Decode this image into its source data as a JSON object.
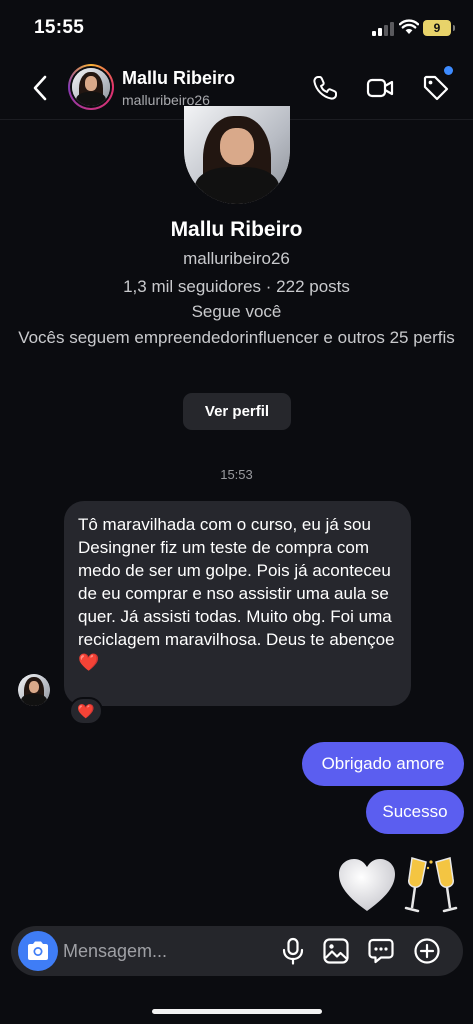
{
  "status_bar": {
    "time": "15:55",
    "battery": "9"
  },
  "header": {
    "name": "Mallu Ribeiro",
    "username": "malluribeiro26"
  },
  "profile": {
    "name": "Mallu Ribeiro",
    "username": "malluribeiro26",
    "stats": "1,3 mil seguidores · 222 posts",
    "follows_you": "Segue você",
    "mutual": "Vocês seguem empreendedorinfluencer e outros 25 perfis",
    "view_profile_label": "Ver perfil"
  },
  "conversation": {
    "timestamp": "15:53",
    "messages": [
      {
        "direction": "incoming",
        "text": "Tô maravilhada com o curso,  eu já sou Desingner fiz um teste de compra com medo de ser um golpe. Pois já aconteceu  de eu comprar e nso assistir uma aula se quer. Já assisti todas.  Muito obg.  Foi uma reciclagem maravilhosa.  Deus te abençoe ❤️",
        "reaction": "❤️"
      },
      {
        "direction": "outgoing",
        "text": "Obrigado amore"
      },
      {
        "direction": "outgoing",
        "text": "Sucesso"
      }
    ],
    "emojis": [
      "white-heart",
      "clinking-glasses"
    ]
  },
  "composer": {
    "placeholder": "Mensagem..."
  },
  "colors": {
    "background": "#0b0c10",
    "outgoing_bubble": "#5b5ef0",
    "incoming_bubble": "#26272d",
    "camera_button": "#3f7df6",
    "notification_dot": "#3d8bff"
  }
}
